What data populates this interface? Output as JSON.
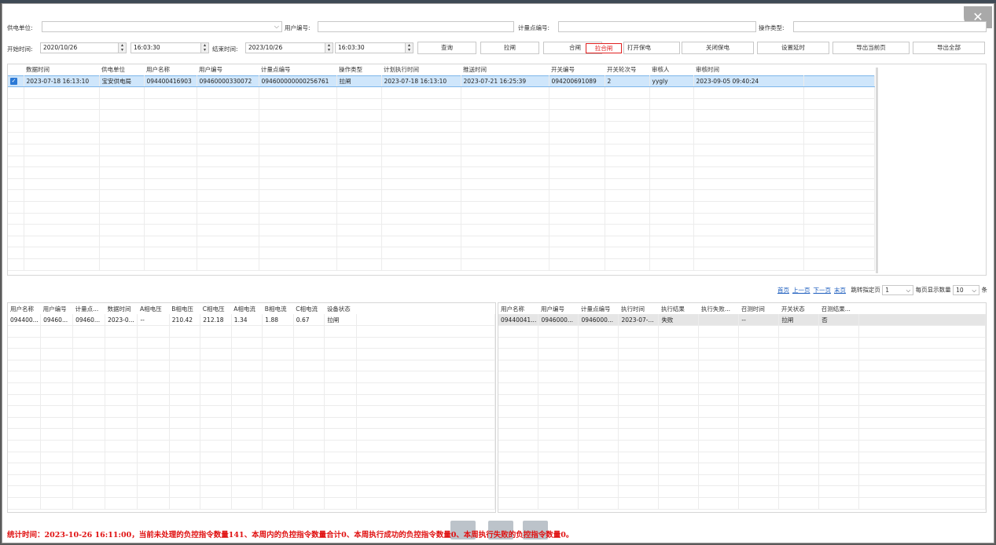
{
  "window": {
    "close_glyph": "✕"
  },
  "filters": {
    "supply_unit_label": "供电单位:",
    "supply_unit_value": "",
    "user_no_label": "用户编号:",
    "user_no_value": "",
    "meter_point_label": "计量点编号:",
    "meter_point_value": "",
    "op_type_label": "操作类型:",
    "op_type_value": "",
    "start_time_label": "开始时间:",
    "start_date": "2020/10/26",
    "start_time": "16:03:30",
    "end_time_label": "结束时间:",
    "end_date": "2023/10/26",
    "end_time": "16:03:30"
  },
  "toolbar": {
    "query": "查询",
    "pull": "拉闸",
    "close": "合闸",
    "pull_close": "拉合闸",
    "open_protect": "打开保电",
    "close_protect": "关闭保电",
    "set_delay": "设置延时",
    "export_page": "导出当前页",
    "export_all": "导出全部"
  },
  "main_table": {
    "columns": [
      "数据时间",
      "供电单位",
      "用户名称",
      "用户编号",
      "计量点编号",
      "操作类型",
      "计划执行时间",
      "推送时间",
      "开关编号",
      "开关轮次号",
      "审核人",
      "审核时间"
    ],
    "rows": [
      [
        "2023-07-18 16:13:10",
        "宝安供电局",
        "094400416903",
        "09460000330072",
        "094600000000256761",
        "拉闸",
        "2023-07-18 16:13:10",
        "2023-07-21 16:25:39",
        "094200691089",
        "2",
        "yygly",
        "2023-09-05 09:40:24"
      ]
    ]
  },
  "pager": {
    "first": "首页",
    "prev": "上一页",
    "next": "下一页",
    "last": "末页",
    "jump_label": "跳转指定页",
    "page_value": "1",
    "page_size_label": "每页显示数量",
    "page_size_value": "10",
    "unit": "条"
  },
  "left_table": {
    "columns": [
      "用户名称",
      "用户编号",
      "计量点...",
      "数据时间",
      "A相电压",
      "B相电压",
      "C相电压",
      "A相电流",
      "B相电流",
      "C相电流",
      "设备状态"
    ],
    "rows": [
      [
        "094400...",
        "09460...",
        "09460...",
        "2023-0...",
        "--",
        "210.42",
        "212.18",
        "1.34",
        "1.88",
        "0.67",
        "拉闸"
      ]
    ]
  },
  "right_table": {
    "columns": [
      "用户名称",
      "用户编号",
      "计量点编号",
      "执行时间",
      "执行结果",
      "执行失败...",
      "召测时间",
      "开关状态",
      "召测结果..."
    ],
    "rows": [
      [
        "09440041...",
        "0946000...",
        "0946000...",
        "2023-07-...",
        "失败",
        "",
        "--",
        "拉闸",
        "否"
      ]
    ]
  },
  "status_bar": {
    "text": "统计时间：2023-10-26 16:11:00，当前未处理的负控指令数量141、本周内的负控指令数量合计0、本周执行成功的负控指令数量0、本周执行失败的负控指令数量0。"
  },
  "colors": {
    "accent_red": "#e01010",
    "selection": "#cfe6fb",
    "link": "#1f5fbf"
  }
}
